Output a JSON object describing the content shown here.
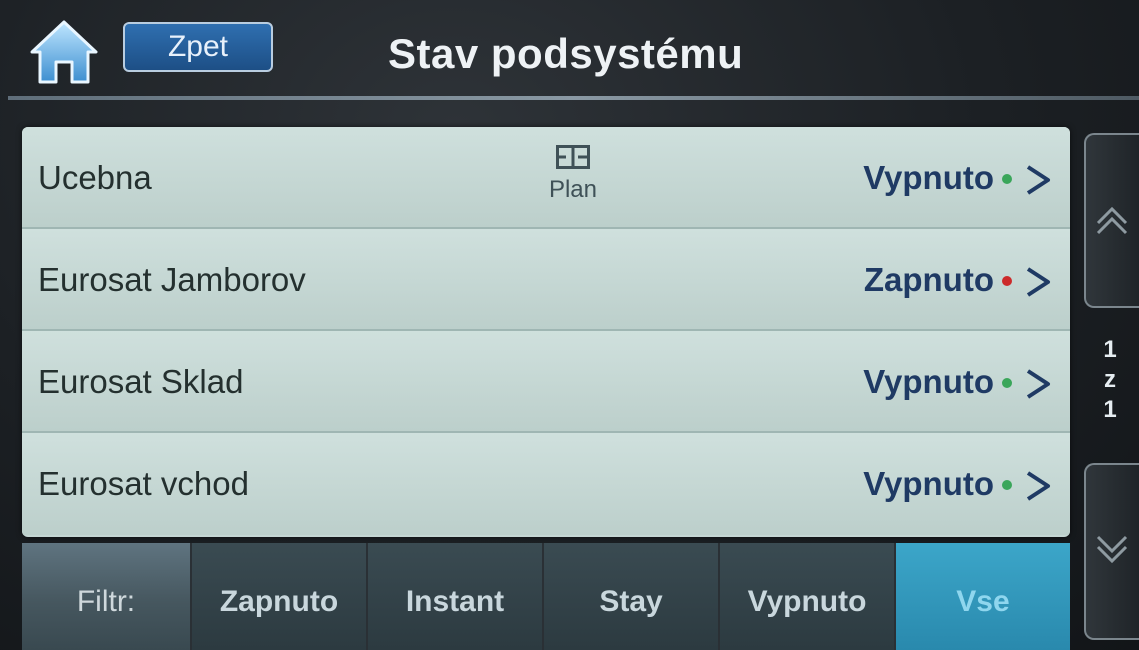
{
  "header": {
    "back_label": "Zpet",
    "title": "Stav podsystému"
  },
  "list": {
    "rows": [
      {
        "name": "Ucebna",
        "plan_label": "Plan",
        "status": "Vypnuto",
        "status_color": "#3aa65a"
      },
      {
        "name": "Eurosat Jamborov",
        "status": "Zapnuto",
        "status_color": "#cc2a2a"
      },
      {
        "name": "Eurosat Sklad",
        "status": "Vypnuto",
        "status_color": "#3aa65a"
      },
      {
        "name": "Eurosat vchod",
        "status": "Vypnuto",
        "status_color": "#3aa65a"
      }
    ]
  },
  "pagination": {
    "current": "1",
    "separator": "z",
    "total": "1"
  },
  "filter": {
    "label": "Filtr:",
    "options": [
      "Zapnuto",
      "Instant",
      "Stay",
      "Vypnuto",
      "Vse"
    ],
    "selected": "Vse"
  },
  "icons": {
    "home": "home-icon",
    "plan": "floor-plan-icon",
    "row_arrow": "chevron-right-icon",
    "scroll_up": "double-chevron-up-icon",
    "scroll_down": "double-chevron-down-icon"
  },
  "colors": {
    "accent": "#2e99bd",
    "status_text": "#1f3a64",
    "list_bg": "#c4d6d3"
  }
}
